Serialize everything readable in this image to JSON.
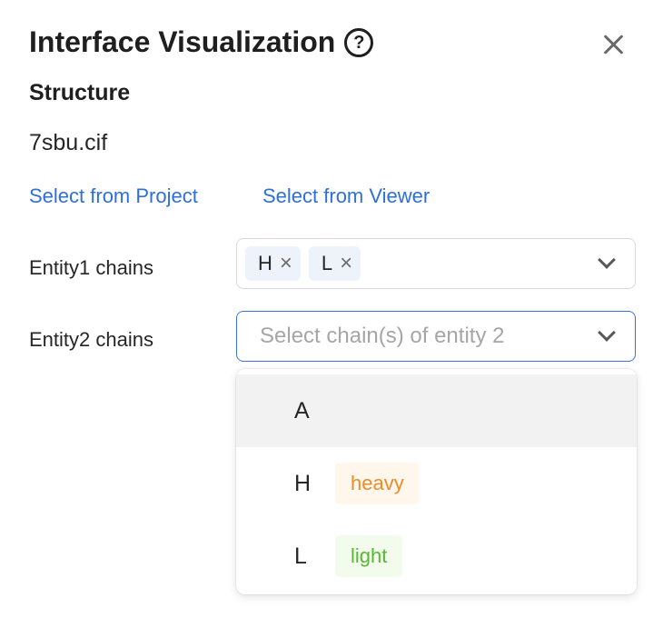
{
  "dialog": {
    "title": "Interface Visualization",
    "help_icon": "?",
    "close_icon": "close-icon"
  },
  "structure": {
    "label": "Structure",
    "file_name": "7sbu.cif",
    "links": {
      "from_project": "Select from Project",
      "from_viewer": "Select from Viewer"
    }
  },
  "entity1": {
    "label": "Entity1 chains",
    "tags": [
      {
        "label": "H"
      },
      {
        "label": "L"
      }
    ]
  },
  "entity2": {
    "label": "Entity2 chains",
    "placeholder": "Select chain(s) of entity 2",
    "options": [
      {
        "chain": "A",
        "badge": "",
        "active": true
      },
      {
        "chain": "H",
        "badge": "heavy",
        "badge_color": "#ec8b2a",
        "badge_bg": "#fff7ec"
      },
      {
        "chain": "L",
        "badge": "light",
        "badge_color": "#56b833",
        "badge_bg": "#f3fbec"
      }
    ]
  },
  "colors": {
    "link": "#2f6fdb",
    "focus_border": "#3b72e0",
    "tag_bg": "#edf2fb"
  }
}
